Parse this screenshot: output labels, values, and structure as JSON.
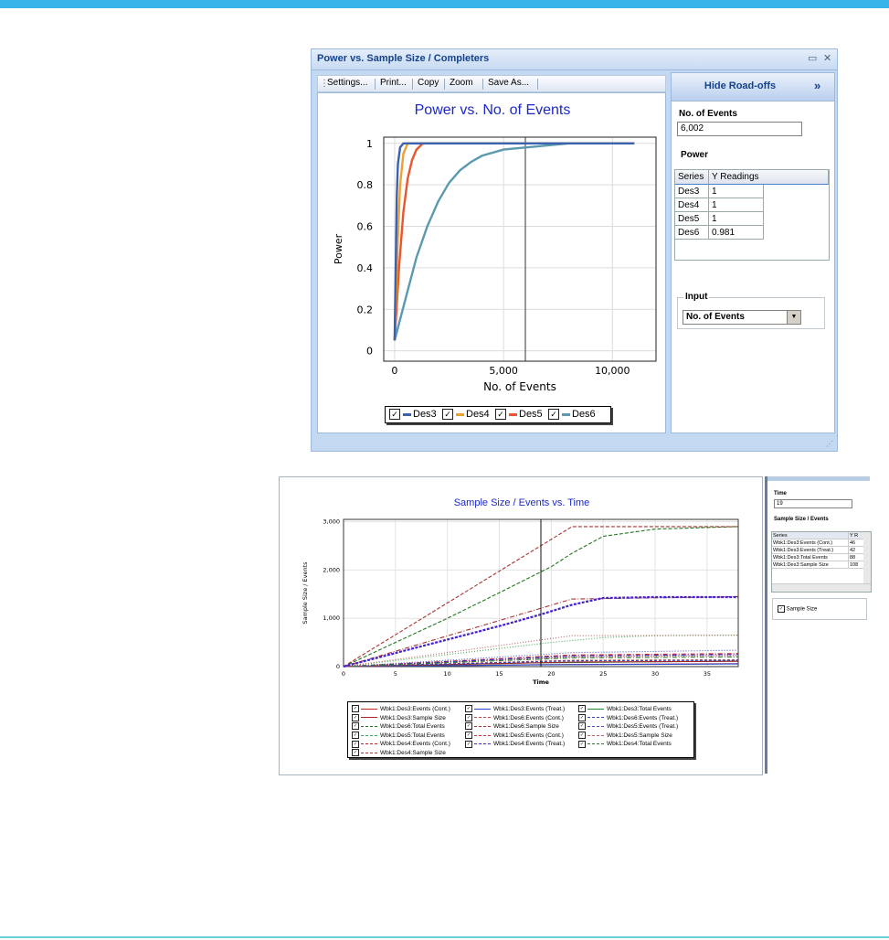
{
  "window1": {
    "title": "Power vs. Sample Size / Completers",
    "toolbar": {
      "settings": "Settings...",
      "print": "Print...",
      "copy": "Copy",
      "zoom": "Zoom",
      "save_as": "Save As..."
    },
    "side": {
      "hide_label": "Hide Road-offs",
      "hide_arrow": "»",
      "field_label": "No. of Events",
      "field_value": "6,002",
      "power_label": "Power",
      "table_headers": [
        "Series",
        "Y Readings"
      ],
      "table_rows": [
        [
          "Des3",
          "1"
        ],
        [
          "Des4",
          "1"
        ],
        [
          "Des5",
          "1"
        ],
        [
          "Des6",
          "0.981"
        ]
      ],
      "input_group_label": "Input",
      "input_select": "No. of Events"
    }
  },
  "chart1": {
    "type": "line",
    "title": "Power vs. No. of Events",
    "xlabel": "No. of Events",
    "ylabel": "Power",
    "xlim": [
      -500,
      12000
    ],
    "ylim": [
      -0.05,
      1.03
    ],
    "xticks": [
      "0",
      "5,000",
      "10,000"
    ],
    "xtick_values": [
      0,
      5000,
      10000
    ],
    "yticks": [
      "0",
      "0.2",
      "0.4",
      "0.6",
      "0.8",
      "1"
    ],
    "ytick_values": [
      0,
      0.2,
      0.4,
      0.6,
      0.8,
      1
    ],
    "cursor_x": 6002,
    "series": [
      {
        "name": "Des3",
        "color": "#3a62b0",
        "x": [
          0,
          100,
          150,
          250,
          400,
          11000
        ],
        "y": [
          0.05,
          0.75,
          0.9,
          0.98,
          1,
          1
        ]
      },
      {
        "name": "Des4",
        "color": "#f0a030",
        "x": [
          0,
          150,
          250,
          400,
          600,
          11000
        ],
        "y": [
          0.05,
          0.55,
          0.8,
          0.95,
          1,
          1
        ]
      },
      {
        "name": "Des5",
        "color": "#e8552e",
        "x": [
          0,
          200,
          400,
          600,
          800,
          1000,
          1300,
          11000
        ],
        "y": [
          0.05,
          0.4,
          0.67,
          0.83,
          0.92,
          0.97,
          1,
          1
        ]
      },
      {
        "name": "Des6",
        "color": "#5b9aae",
        "x": [
          0,
          500,
          1000,
          1500,
          2000,
          2500,
          3000,
          3500,
          4000,
          5000,
          6000,
          7000,
          8000,
          11000
        ],
        "y": [
          0.05,
          0.25,
          0.45,
          0.6,
          0.72,
          0.81,
          0.87,
          0.91,
          0.94,
          0.97,
          0.98,
          0.99,
          1,
          1
        ]
      }
    ]
  },
  "window2": {
    "side": {
      "time_label": "Time",
      "time_value": "19",
      "grid_label": "Sample Size / Events",
      "table_headers": [
        "Series",
        "Y R"
      ],
      "table_rows": [
        [
          "Wbk1:Des3:Events (Cont.)",
          "46"
        ],
        [
          "Wbk1:Des3:Events (Treat.)",
          "42"
        ],
        [
          "Wbk1:Des3:Total Events",
          "88"
        ],
        [
          "Wbk1:Des3:Sample Size",
          "108"
        ]
      ],
      "checkbox_label": "Sample Size"
    }
  },
  "chart2": {
    "type": "line",
    "title": "Sample Size / Events vs. Time",
    "xlabel": "Time",
    "ylabel": "Sample Size / Events",
    "xlim": [
      0,
      38
    ],
    "ylim": [
      0,
      3050
    ],
    "xticks": [
      "0",
      "5",
      "10",
      "15",
      "20",
      "25",
      "30",
      "35"
    ],
    "xtick_values": [
      0,
      5,
      10,
      15,
      20,
      25,
      30,
      35
    ],
    "yticks": [
      "0",
      "1,000",
      "2,000",
      "3,000"
    ],
    "ytick_values": [
      0,
      1000,
      2000,
      3000
    ],
    "cursor_x": 19,
    "series": [
      {
        "name": "Wbk1:Des3:Events (Cont.)",
        "color": "#cc2222",
        "dash": "",
        "x": [
          0,
          18,
          38
        ],
        "y": [
          0,
          40,
          60
        ]
      },
      {
        "name": "Wbk1:Des3:Events (Treat.)",
        "color": "#2244cc",
        "dash": "",
        "x": [
          0,
          18,
          38
        ],
        "y": [
          0,
          36,
          55
        ]
      },
      {
        "name": "Wbk1:Des3:Total Events",
        "color": "#228833",
        "dash": "",
        "x": [
          0,
          18,
          38
        ],
        "y": [
          0,
          76,
          115
        ]
      },
      {
        "name": "Wbk1:Des3:Sample Size",
        "color": "#aa2222",
        "dash": "",
        "x": [
          0,
          22,
          38
        ],
        "y": [
          0,
          95,
          110
        ]
      },
      {
        "name": "Wbk1:Des6:Events (Cont.)",
        "color": "#cc4444",
        "dash": "3,2",
        "x": [
          0,
          22,
          38
        ],
        "y": [
          0,
          130,
          140
        ]
      },
      {
        "name": "Wbk1:Des6:Events (Treat.)",
        "color": "#3344cc",
        "dash": "3,2",
        "x": [
          0,
          22,
          38
        ],
        "y": [
          0,
          120,
          130
        ]
      },
      {
        "name": "Wbk1:Des6:Total Events",
        "color": "#227722",
        "dash": "4,2",
        "x": [
          0,
          5,
          10,
          15,
          20,
          22,
          25,
          30,
          38
        ],
        "y": [
          0,
          500,
          1000,
          1530,
          2070,
          2350,
          2700,
          2850,
          2900
        ]
      },
      {
        "name": "Wbk1:Des6:Sample Size",
        "color": "#aa3333",
        "dash": "4,2",
        "x": [
          0,
          22,
          38
        ],
        "y": [
          0,
          2900,
          2900
        ]
      },
      {
        "name": "Wbk1:Des5:Events (Treat.)",
        "color": "#4455cc",
        "dash": "1,2",
        "x": [
          0,
          22,
          38
        ],
        "y": [
          0,
          290,
          340
        ]
      },
      {
        "name": "Wbk1:Des5:Total Events",
        "color": "#44aa55",
        "dash": "1,2",
        "x": [
          0,
          10,
          20,
          25,
          30,
          38
        ],
        "y": [
          0,
          250,
          500,
          600,
          640,
          650
        ]
      },
      {
        "name": "Wbk1:Des5:Events (Cont.)",
        "color": "#cc3333",
        "dash": "1,2",
        "x": [
          0,
          22,
          38
        ],
        "y": [
          0,
          200,
          230
        ]
      },
      {
        "name": "Wbk1:Des5:Sample Size",
        "color": "#bb6666",
        "dash": "1,2",
        "x": [
          0,
          22,
          38
        ],
        "y": [
          0,
          640,
          650
        ]
      },
      {
        "name": "Wbk1:Des4:Events (Cont.)",
        "color": "#cc2222",
        "dash": "5,2,1,2",
        "x": [
          0,
          22,
          38
        ],
        "y": [
          0,
          240,
          270
        ]
      },
      {
        "name": "Wbk1:Des4:Events (Treat.)",
        "color": "#3333cc",
        "dash": "5,2,1,2",
        "x": [
          0,
          22,
          38
        ],
        "y": [
          0,
          220,
          250
        ]
      },
      {
        "name": "Wbk1:Des4:Total Events",
        "color": "#337733",
        "dash": "5,2,1,2",
        "x": [
          0,
          22,
          38
        ],
        "y": [
          0,
          180,
          200
        ]
      },
      {
        "name": "Wbk1:Des4:Sample Size",
        "color": "#aa3333",
        "dash": "5,2,1,2",
        "x": [
          0,
          22,
          38
        ],
        "y": [
          0,
          1400,
          1450
        ]
      }
    ]
  },
  "chart2_overlay": {
    "name": "Des4 total (bold)",
    "color": "#4422cc",
    "x": [
      0,
      5,
      10,
      15,
      19,
      22,
      25,
      30,
      38
    ],
    "y": [
      0,
      280,
      560,
      840,
      1080,
      1280,
      1420,
      1440,
      1440
    ]
  }
}
